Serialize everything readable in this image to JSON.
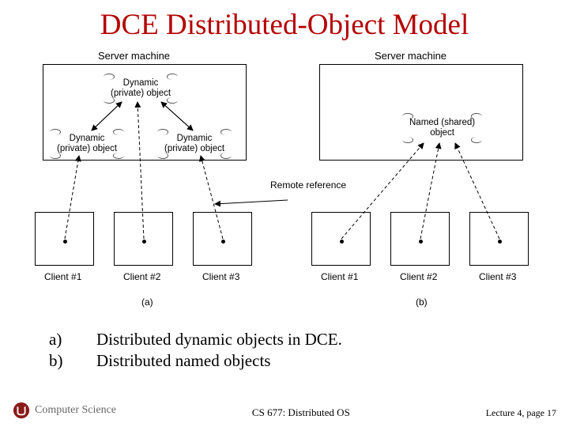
{
  "title": "DCE Distributed-Object Model",
  "diagram": {
    "serverLabelLeft": "Server machine",
    "serverLabelRight": "Server machine",
    "dynObj1": "Dynamic\n(private) object",
    "dynObj2": "Dynamic\n(private) object",
    "dynObj3": "Dynamic\n(private) object",
    "namedObj": "Named (shared)\nobject",
    "remoteRef": "Remote\nreference",
    "client1a": "Client #1",
    "client2a": "Client #2",
    "client3a": "Client #3",
    "client1b": "Client #1",
    "client2b": "Client #2",
    "client3b": "Client #3",
    "labelA": "(a)",
    "labelB": "(b)"
  },
  "bullets": {
    "a_letter": "a)",
    "a_text": "Distributed dynamic objects in DCE.",
    "b_letter": "b)",
    "b_text": "Distributed named objects"
  },
  "footer": {
    "cs": "Computer Science",
    "course": "CS 677: Distributed OS",
    "lecture": "Lecture 4, page 17"
  }
}
